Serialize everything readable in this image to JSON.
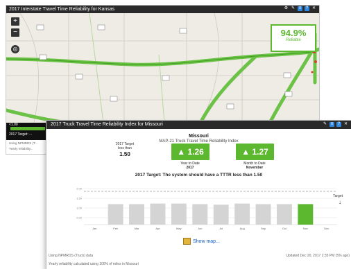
{
  "back_window": {
    "title": "2017 Interstate Travel Time Reliability for Kansas",
    "reliability_value": "94.9%",
    "reliability_label": "Reliable",
    "strip_top": "<1.00",
    "strip_target": "2017 Target: ...",
    "strip_footer1": "Using NPMRDS (T...",
    "strip_footer2": "Yearly reliability..."
  },
  "front_window": {
    "title": "2017 Truck Travel Time Reliability Index for Missouri",
    "state": "Missouri",
    "subtitle": "MAP-21 Truck Travel Time Reliability Index",
    "target_label_1": "2017 Target",
    "target_label_2": "less than",
    "target_value": "1.50",
    "ytd_value": "1.26",
    "ytd_caption_1": "Year to Date",
    "ytd_caption_2": "2017",
    "mtd_value": "1.27",
    "mtd_caption_1": "Month to Date",
    "mtd_caption_2": "November",
    "target_sentence": "2017 Target: The system should have a TTTR less than 1.50",
    "show_map": "Show map...",
    "footer_left": "Using NPMRDS (Truck) data",
    "footer_left_2": "Yearly reliability calculated using 100% of miles in Missouri",
    "footer_right": "Updated Dec 20, 2017 2:35 PM (5% ago)",
    "chart_right_label": "Target"
  },
  "chart_data": {
    "type": "bar",
    "categories": [
      "Jan",
      "Feb",
      "Mar",
      "Apr",
      "May",
      "Jun",
      "Jul",
      "Aug",
      "Sep",
      "Oct",
      "Nov",
      "Dec"
    ],
    "values": [
      null,
      1.27,
      1.27,
      1.28,
      1.28,
      1.27,
      1.26,
      1.28,
      1.27,
      1.27,
      1.27,
      null
    ],
    "highlight_index": 10,
    "target": 1.5,
    "ylim": [
      0.9,
      1.55
    ],
    "yticks": [
      "2.00",
      "1.50",
      "1.00",
      "0.00"
    ],
    "colors": {
      "bar": "#d4d4d4",
      "highlight": "#5cb82e",
      "target": "#9a9a9a"
    }
  },
  "colors": {
    "accent": "#5cb82e",
    "titlebar": "#2a2a2a"
  }
}
